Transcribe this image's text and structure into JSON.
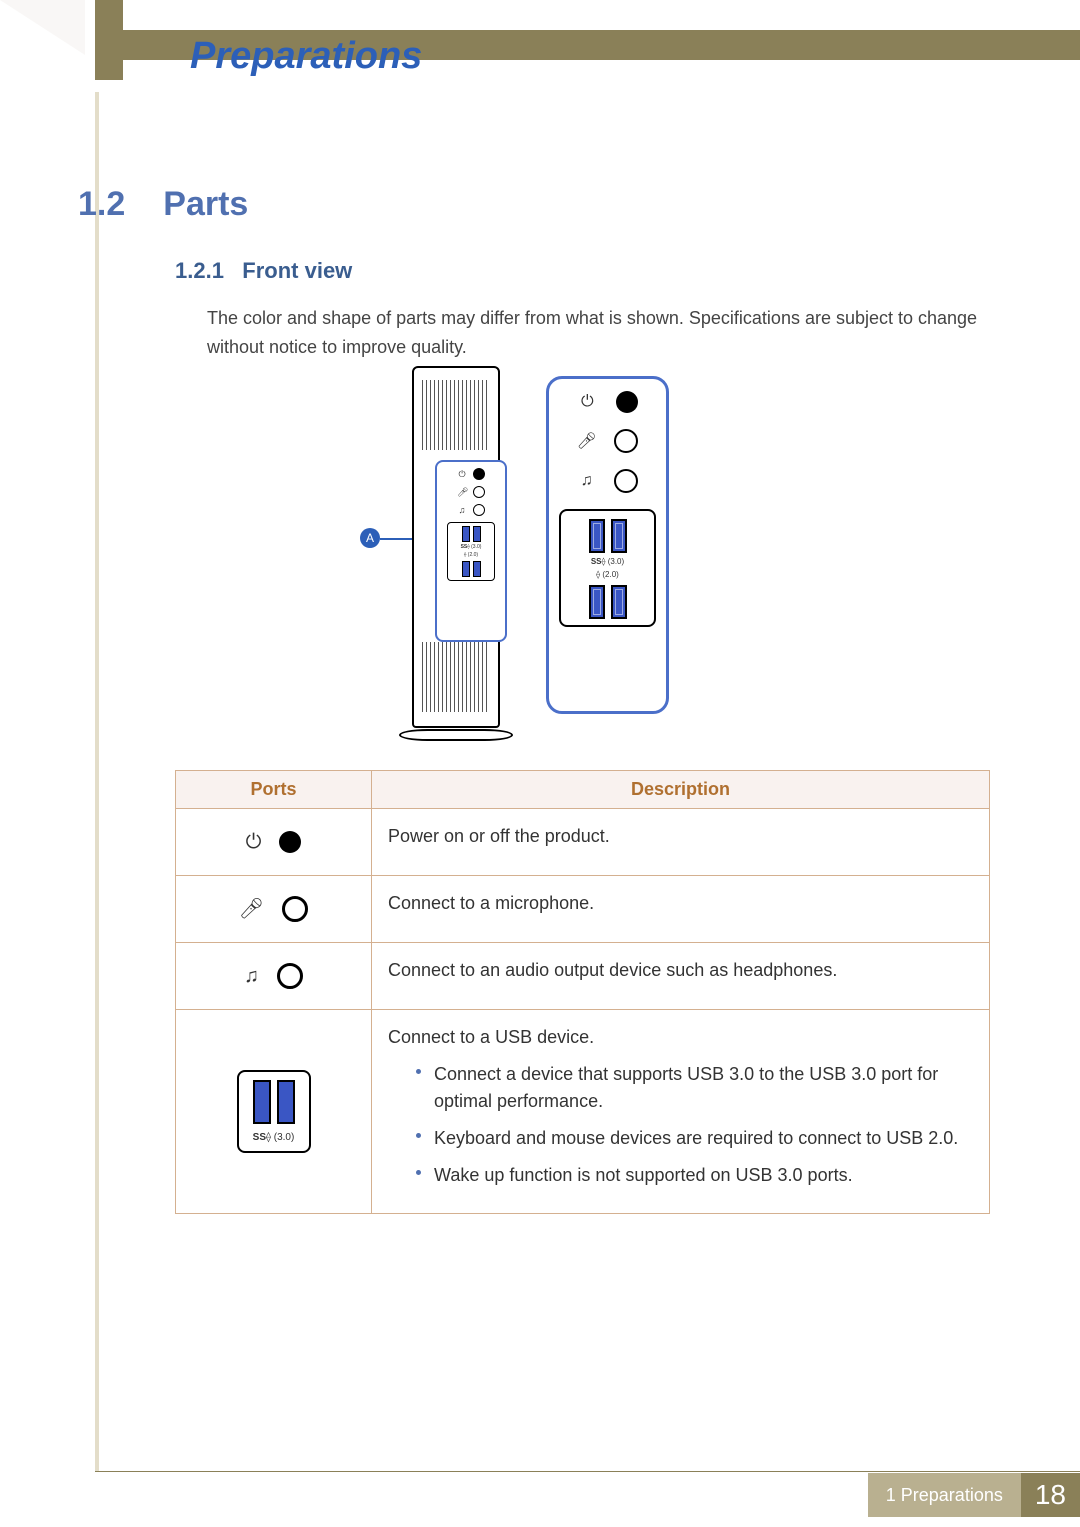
{
  "header": {
    "chapter_title": "Preparations"
  },
  "section": {
    "number": "1.2",
    "title": "Parts"
  },
  "subsection": {
    "number": "1.2.1",
    "title": "Front view"
  },
  "note": "The color and shape of parts may differ from what is shown. Specifications are subject to change without notice to improve quality.",
  "callout_badge": "A",
  "usb_labels": {
    "usb30": "(3.0)",
    "usb20": "(2.0)",
    "ss_prefix": "SS"
  },
  "table": {
    "headers": {
      "ports": "Ports",
      "description": "Description"
    },
    "rows": [
      {
        "icon": "power",
        "description": "Power on or off the product."
      },
      {
        "icon": "mic",
        "description": "Connect to a microphone."
      },
      {
        "icon": "headphone",
        "description": "Connect to an audio output device such as headphones."
      },
      {
        "icon": "usb",
        "description": "Connect to a USB device.",
        "bullets": [
          "Connect a device that supports USB 3.0 to the USB 3.0 port for optimal performance.",
          "Keyboard and mouse devices are required to connect to USB 2.0.",
          "Wake up function is not supported on USB 3.0 ports."
        ]
      }
    ]
  },
  "footer": {
    "chapter_ref": "1 Preparations",
    "page": "18"
  }
}
